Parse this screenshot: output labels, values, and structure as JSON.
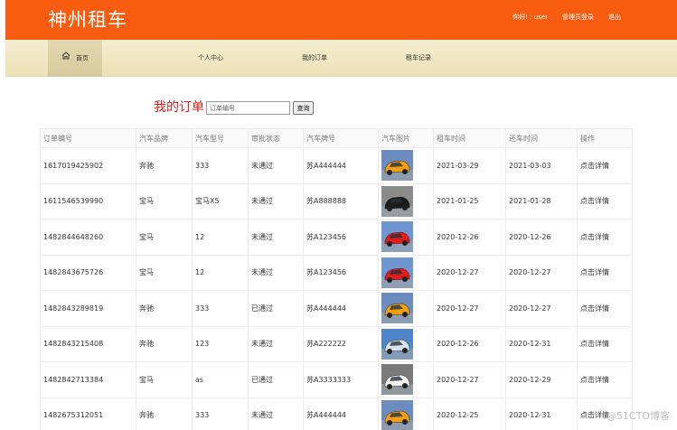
{
  "header": {
    "brand": "神州租车",
    "greeting": "你好! : user",
    "admin_login": "管理员登录",
    "logout": "退出"
  },
  "nav": {
    "items": [
      {
        "label": "首页"
      },
      {
        "label": "个人中心"
      },
      {
        "label": "我的订单"
      },
      {
        "label": "租车记录"
      }
    ]
  },
  "main": {
    "title": "我的订单",
    "search_placeholder": "订单编号",
    "search_button": "查询"
  },
  "table": {
    "columns": [
      "订单编号",
      "汽车品牌",
      "汽车型号",
      "审批状态",
      "汽车牌号",
      "汽车图片",
      "租车时间",
      "还车时间",
      "操作"
    ],
    "rows": [
      {
        "id": "1617019425902",
        "brand": "奔驰",
        "model": "333",
        "status": "未通过",
        "plate": "苏A444444",
        "car": "yellow",
        "rent": "2021-03-29",
        "return": "2021-03-03",
        "action": "点击详情"
      },
      {
        "id": "1611546539990",
        "brand": "宝马",
        "model": "宝马X5",
        "status": "未通过",
        "plate": "苏A888888",
        "car": "black",
        "rent": "2021-01-25",
        "return": "2021-01-28",
        "action": "点击详情"
      },
      {
        "id": "1482844648260",
        "brand": "宝马",
        "model": "12",
        "status": "未通过",
        "plate": "苏A123456",
        "car": "red",
        "rent": "2020-12-26",
        "return": "2020-12-26",
        "action": "点击详情"
      },
      {
        "id": "1482843675726",
        "brand": "宝马",
        "model": "12",
        "status": "未通过",
        "plate": "苏A123456",
        "car": "red",
        "rent": "2020-12-27",
        "return": "2020-12-27",
        "action": "点击详情"
      },
      {
        "id": "1482843289819",
        "brand": "奔驰",
        "model": "333",
        "status": "已通过",
        "plate": "苏A444444",
        "car": "yellow",
        "rent": "2020-12-27",
        "return": "2020-12-27",
        "action": "点击详情"
      },
      {
        "id": "1482843215408",
        "brand": "奔驰",
        "model": "123",
        "status": "未通过",
        "plate": "苏A222222",
        "car": "blue",
        "rent": "2020-12-26",
        "return": "2020-12-31",
        "action": "点击详情"
      },
      {
        "id": "1482842713384",
        "brand": "宝马",
        "model": "as",
        "status": "已通过",
        "plate": "苏A3333333",
        "car": "white",
        "rent": "2020-12-27",
        "return": "2020-12-29",
        "action": "点击详情"
      },
      {
        "id": "1482675312051",
        "brand": "奔驰",
        "model": "333",
        "status": "未通过",
        "plate": "苏A444444",
        "car": "yellow",
        "rent": "2020-12-25",
        "return": "2020-12-31",
        "action": "点击详情"
      }
    ]
  },
  "watermark": "@51CTO博客",
  "colors": {
    "header_bg": "#f85c11",
    "nav_bg": "#efe6c2",
    "title_red": "#e21c1c"
  },
  "icons": {
    "home": "home-icon"
  },
  "car_colors": {
    "yellow": {
      "body": "#f0a010",
      "bg": "#6c8cc0"
    },
    "black": {
      "body": "#1b1b1b",
      "bg": "#8c8c8c"
    },
    "red": {
      "body": "#e31b1b",
      "bg": "#6f96cf"
    },
    "blue": {
      "body": "#d8e4f0",
      "bg": "#4f86c8"
    },
    "white": {
      "body": "#f2f2f2",
      "bg": "#7a7a7a"
    }
  }
}
